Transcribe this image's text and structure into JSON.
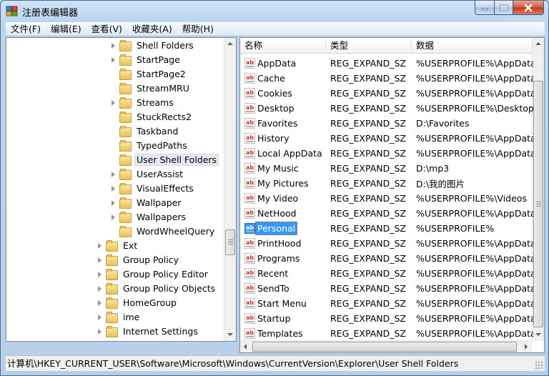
{
  "window": {
    "title": "注册表编辑器"
  },
  "menu": [
    "文件(F)",
    "编辑(E)",
    "查看(V)",
    "收藏夹(A)",
    "帮助(H)"
  ],
  "tree": [
    {
      "label": "Shell Folders",
      "level": 2,
      "expander": true
    },
    {
      "label": "StartPage",
      "level": 2,
      "expander": true
    },
    {
      "label": "StartPage2",
      "level": 2,
      "expander": false
    },
    {
      "label": "StreamMRU",
      "level": 2,
      "expander": false
    },
    {
      "label": "Streams",
      "level": 2,
      "expander": true
    },
    {
      "label": "StuckRects2",
      "level": 2,
      "expander": false
    },
    {
      "label": "Taskband",
      "level": 2,
      "expander": false
    },
    {
      "label": "TypedPaths",
      "level": 2,
      "expander": false
    },
    {
      "label": "User Shell Folders",
      "level": 2,
      "expander": false,
      "selected": true
    },
    {
      "label": "UserAssist",
      "level": 2,
      "expander": true
    },
    {
      "label": "VisualEffects",
      "level": 2,
      "expander": true
    },
    {
      "label": "Wallpaper",
      "level": 2,
      "expander": true
    },
    {
      "label": "Wallpapers",
      "level": 2,
      "expander": true
    },
    {
      "label": "WordWheelQuery",
      "level": 2,
      "expander": false
    },
    {
      "label": "Ext",
      "level": 1,
      "expander": true
    },
    {
      "label": "Group Policy",
      "level": 1,
      "expander": true
    },
    {
      "label": "Group Policy Editor",
      "level": 1,
      "expander": true
    },
    {
      "label": "Group Policy Objects",
      "level": 1,
      "expander": true
    },
    {
      "label": "HomeGroup",
      "level": 1,
      "expander": true
    },
    {
      "label": "ime",
      "level": 1,
      "expander": true
    },
    {
      "label": "Internet Settings",
      "level": 1,
      "expander": true
    }
  ],
  "columns": {
    "name": "名称",
    "type": "类型",
    "data": "数据"
  },
  "values": [
    {
      "name": "AppData",
      "type": "REG_EXPAND_SZ",
      "data": "%USERPROFILE%\\AppData\\"
    },
    {
      "name": "Cache",
      "type": "REG_EXPAND_SZ",
      "data": "%USERPROFILE%\\AppData\\"
    },
    {
      "name": "Cookies",
      "type": "REG_EXPAND_SZ",
      "data": "%USERPROFILE%\\AppData\\"
    },
    {
      "name": "Desktop",
      "type": "REG_EXPAND_SZ",
      "data": "%USERPROFILE%\\Desktop"
    },
    {
      "name": "Favorites",
      "type": "REG_EXPAND_SZ",
      "data": "D:\\Favorites"
    },
    {
      "name": "History",
      "type": "REG_EXPAND_SZ",
      "data": "%USERPROFILE%\\AppData\\"
    },
    {
      "name": "Local AppData",
      "type": "REG_EXPAND_SZ",
      "data": "%USERPROFILE%\\AppData\\"
    },
    {
      "name": "My Music",
      "type": "REG_EXPAND_SZ",
      "data": "D:\\mp3"
    },
    {
      "name": "My Pictures",
      "type": "REG_EXPAND_SZ",
      "data": "D:\\我的图片"
    },
    {
      "name": "My Video",
      "type": "REG_EXPAND_SZ",
      "data": "%USERPROFILE%\\Videos"
    },
    {
      "name": "NetHood",
      "type": "REG_EXPAND_SZ",
      "data": "%USERPROFILE%\\AppData\\"
    },
    {
      "name": "Personal",
      "type": "REG_EXPAND_SZ",
      "data": "%USERPROFILE%",
      "selected": true
    },
    {
      "name": "PrintHood",
      "type": "REG_EXPAND_SZ",
      "data": "%USERPROFILE%\\AppData\\"
    },
    {
      "name": "Programs",
      "type": "REG_EXPAND_SZ",
      "data": "%USERPROFILE%\\AppData\\"
    },
    {
      "name": "Recent",
      "type": "REG_EXPAND_SZ",
      "data": "%USERPROFILE%\\AppData\\"
    },
    {
      "name": "SendTo",
      "type": "REG_EXPAND_SZ",
      "data": "%USERPROFILE%\\AppData\\"
    },
    {
      "name": "Start Menu",
      "type": "REG_EXPAND_SZ",
      "data": "%USERPROFILE%\\AppData\\"
    },
    {
      "name": "Startup",
      "type": "REG_EXPAND_SZ",
      "data": "%USERPROFILE%\\AppData\\"
    },
    {
      "name": "Templates",
      "type": "REG_EXPAND_SZ",
      "data": "%USERPROFILE%\\AppData\\"
    }
  ],
  "value_icon": "ab",
  "status": "计算机\\HKEY_CURRENT_USER\\Software\\Microsoft\\Windows\\CurrentVersion\\Explorer\\User Shell Folders"
}
